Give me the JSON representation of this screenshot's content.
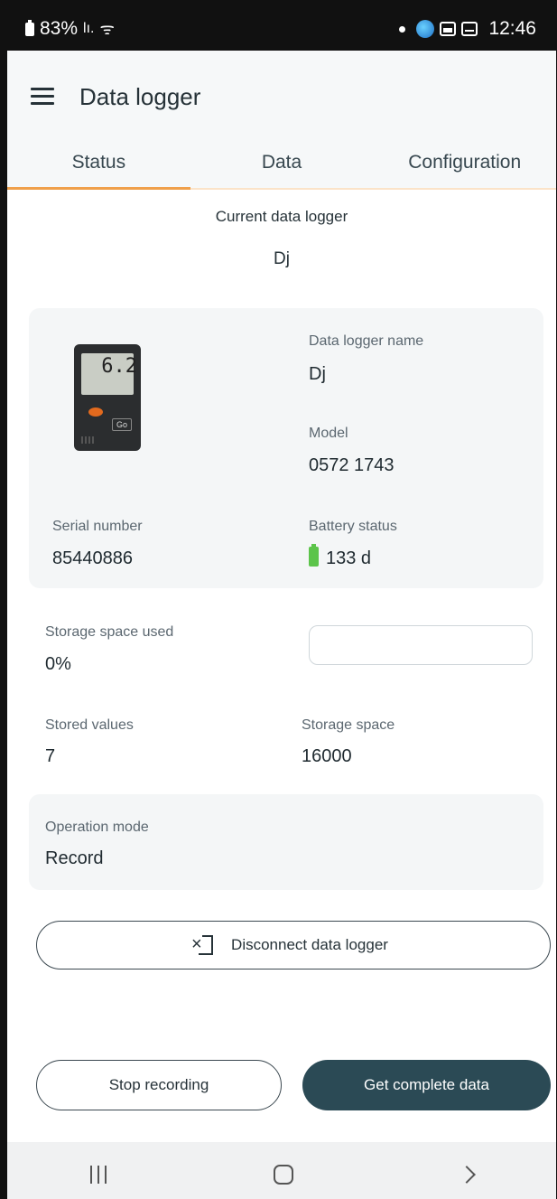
{
  "status_bar": {
    "battery": "83%",
    "signal": "lı.",
    "wifi": "ᯤ",
    "time": "12:46"
  },
  "app_bar": {
    "title": "Data logger"
  },
  "tabs": [
    {
      "label": "Status",
      "active": true
    },
    {
      "label": "Data",
      "active": false
    },
    {
      "label": "Configuration",
      "active": false
    }
  ],
  "current_logger": {
    "label": "Current data logger",
    "name": "Dj"
  },
  "device_card": {
    "device_reading": "6.2",
    "device_button": "Go",
    "name_label": "Data logger name",
    "name_value": "Dj",
    "model_label": "Model",
    "model_value": "0572 1743",
    "serial_label": "Serial number",
    "serial_value": "85440886",
    "battery_label": "Battery status",
    "battery_value": "133 d",
    "battery_color": "#5cc44a"
  },
  "storage": {
    "used_label": "Storage space used",
    "used_value": "0%",
    "used_fraction": 0,
    "stored_label": "Stored values",
    "stored_value": "7",
    "space_label": "Storage space",
    "space_value": "16000"
  },
  "mode": {
    "label": "Operation mode",
    "value": "Record"
  },
  "buttons": {
    "disconnect": "Disconnect data logger",
    "stop": "Stop recording",
    "get_data": "Get complete data"
  },
  "colors": {
    "accent": "#f0a04b",
    "primary": "#2b4a55"
  }
}
